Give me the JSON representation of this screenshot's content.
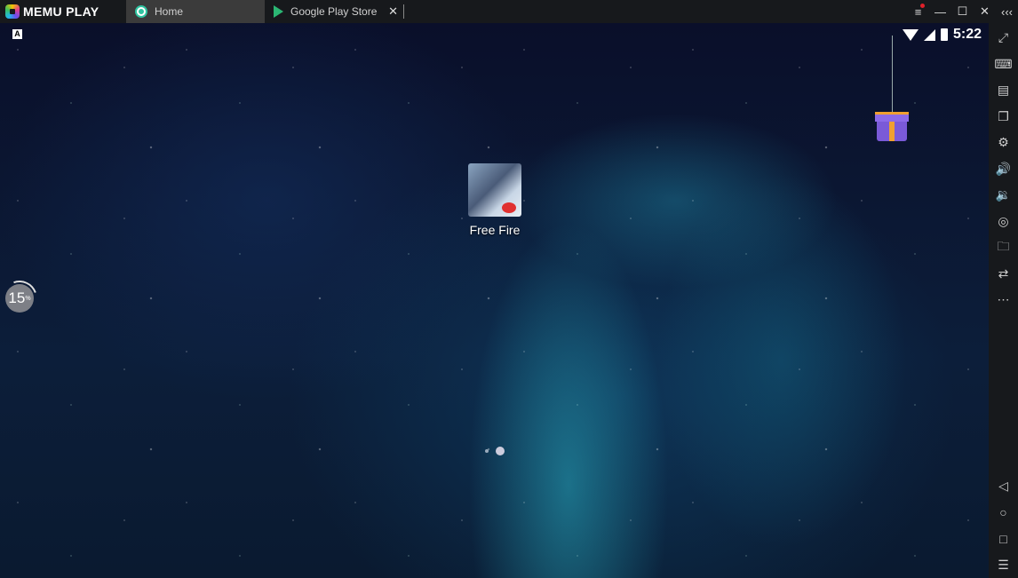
{
  "titlebar": {
    "brand": "MEMU PLAY",
    "tabs": [
      {
        "label": "Home",
        "active": true
      },
      {
        "label": "Google Play Store",
        "active": false
      }
    ],
    "controls": {
      "menu": "≡",
      "minimize": "—",
      "maximize": "☐",
      "close": "✕",
      "collapse": "‹‹‹"
    }
  },
  "status": {
    "time": "5:22"
  },
  "keyboard_indicator": "A",
  "apps": [
    {
      "label": "Free Fire"
    }
  ],
  "progress": {
    "value": "15",
    "unit": "%",
    "percent": 15
  },
  "pager": {
    "pages": 2,
    "current": 2
  },
  "sidebar": {
    "items": [
      {
        "name": "fullscreen-icon",
        "glyph": "⤢"
      },
      {
        "name": "keyboard-mapping-icon",
        "glyph": "⌨"
      },
      {
        "name": "gamepad-icon",
        "glyph": "▤"
      },
      {
        "name": "multi-window-icon",
        "glyph": "❐"
      },
      {
        "name": "settings-icon",
        "glyph": "⚙"
      },
      {
        "name": "volume-up-icon",
        "glyph": "🔊"
      },
      {
        "name": "volume-down-icon",
        "glyph": "🔉"
      },
      {
        "name": "location-icon",
        "glyph": "◎"
      },
      {
        "name": "folder-icon",
        "glyph": "🗀"
      },
      {
        "name": "rotate-icon",
        "glyph": "⇄"
      },
      {
        "name": "more-icon",
        "glyph": "⋯"
      }
    ],
    "nav": [
      {
        "name": "back-icon",
        "glyph": "◁"
      },
      {
        "name": "home-icon",
        "glyph": "○"
      },
      {
        "name": "recents-icon",
        "glyph": "□"
      },
      {
        "name": "menu-list-icon",
        "glyph": "☰"
      }
    ]
  }
}
